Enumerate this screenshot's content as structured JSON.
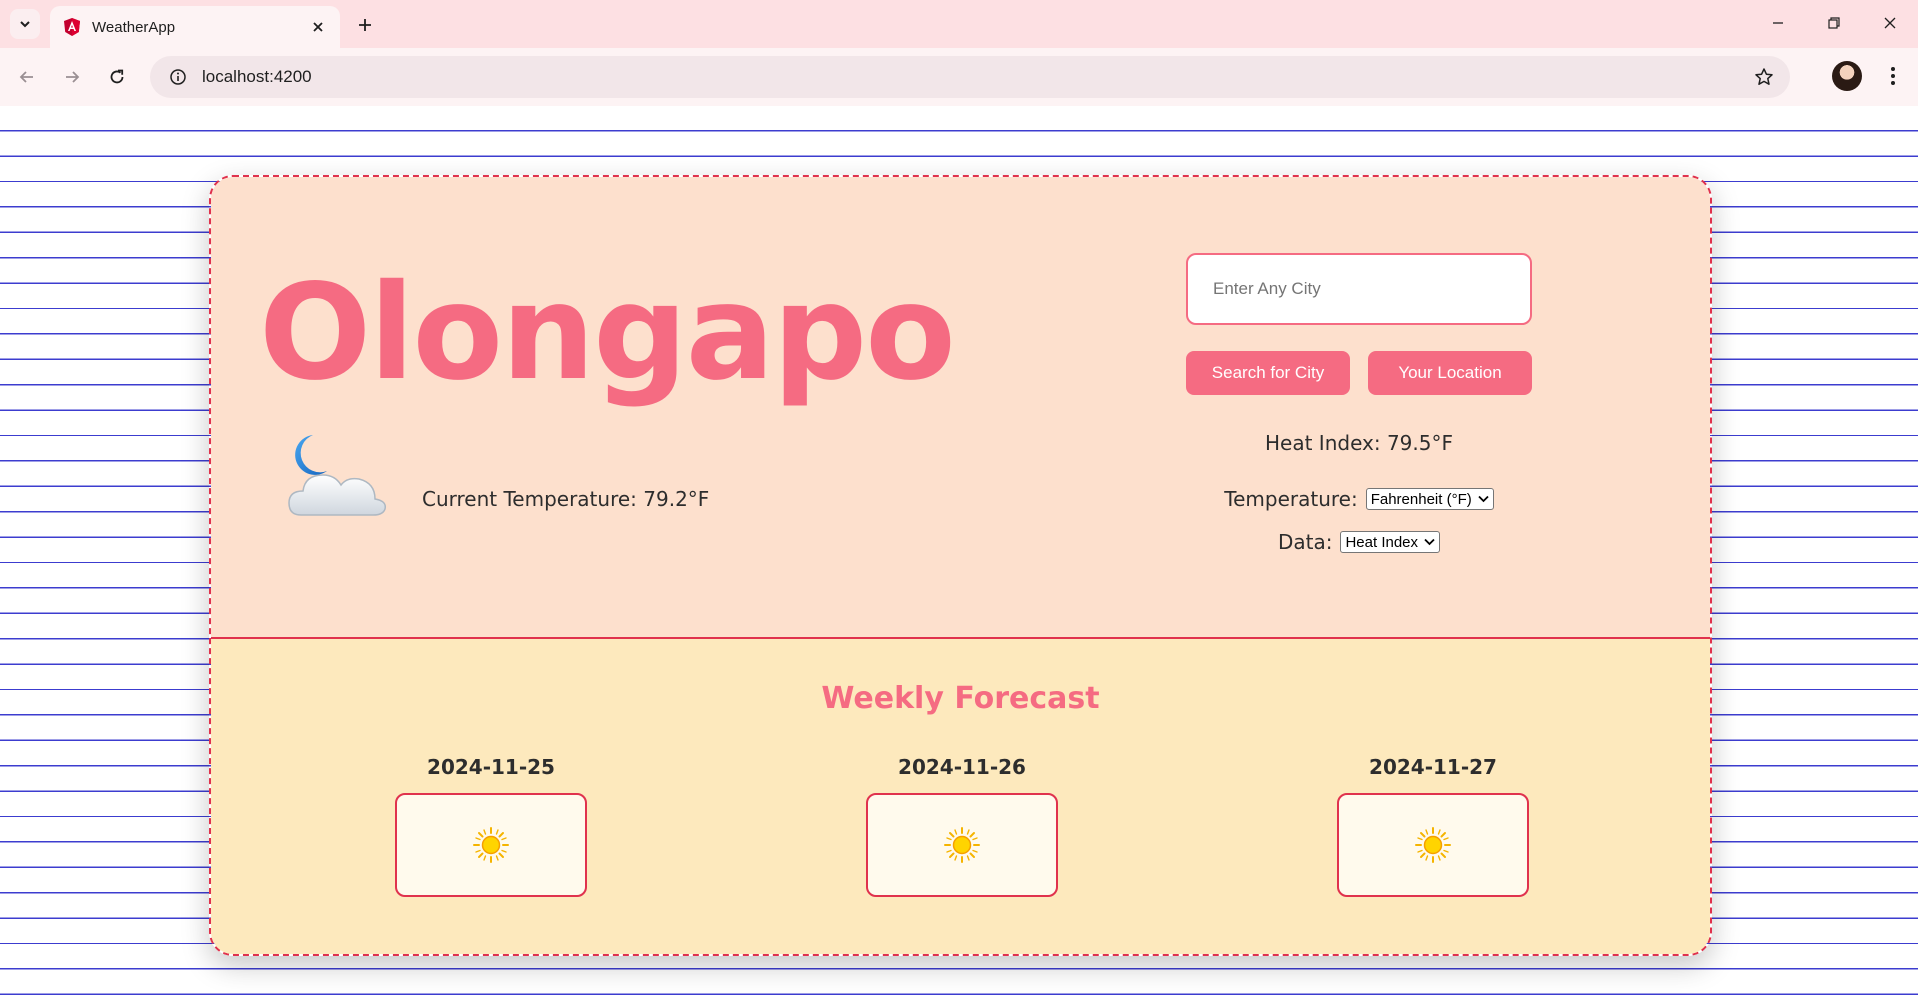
{
  "browser": {
    "tab_title": "WeatherApp",
    "url": "localhost:4200"
  },
  "colors": {
    "accent": "#f56b82",
    "border": "#e0324d",
    "top_bg": "#fde0cd",
    "bottom_bg": "#fde9bd",
    "ruled_line": "#3c3ccf"
  },
  "weather": {
    "city": "Olongapo",
    "icon": "moon-cloud-icon",
    "current_temperature": "Current Temperature: 79.2°F"
  },
  "search": {
    "placeholder": "Enter Any City",
    "value": "",
    "search_button": "Search for City",
    "location_button": "Your Location"
  },
  "heat_index": "Heat Index: 79.5°F",
  "settings": {
    "temperature_label": "Temperature:",
    "temperature_value": "Fahrenheit (°F)",
    "data_label": "Data:",
    "data_value": "Heat Index"
  },
  "forecast": {
    "title": "Weekly Forecast",
    "days": [
      {
        "date": "2024-11-25",
        "icon": "sun-icon"
      },
      {
        "date": "2024-11-26",
        "icon": "sun-icon"
      },
      {
        "date": "2024-11-27",
        "icon": "sun-icon"
      }
    ]
  }
}
